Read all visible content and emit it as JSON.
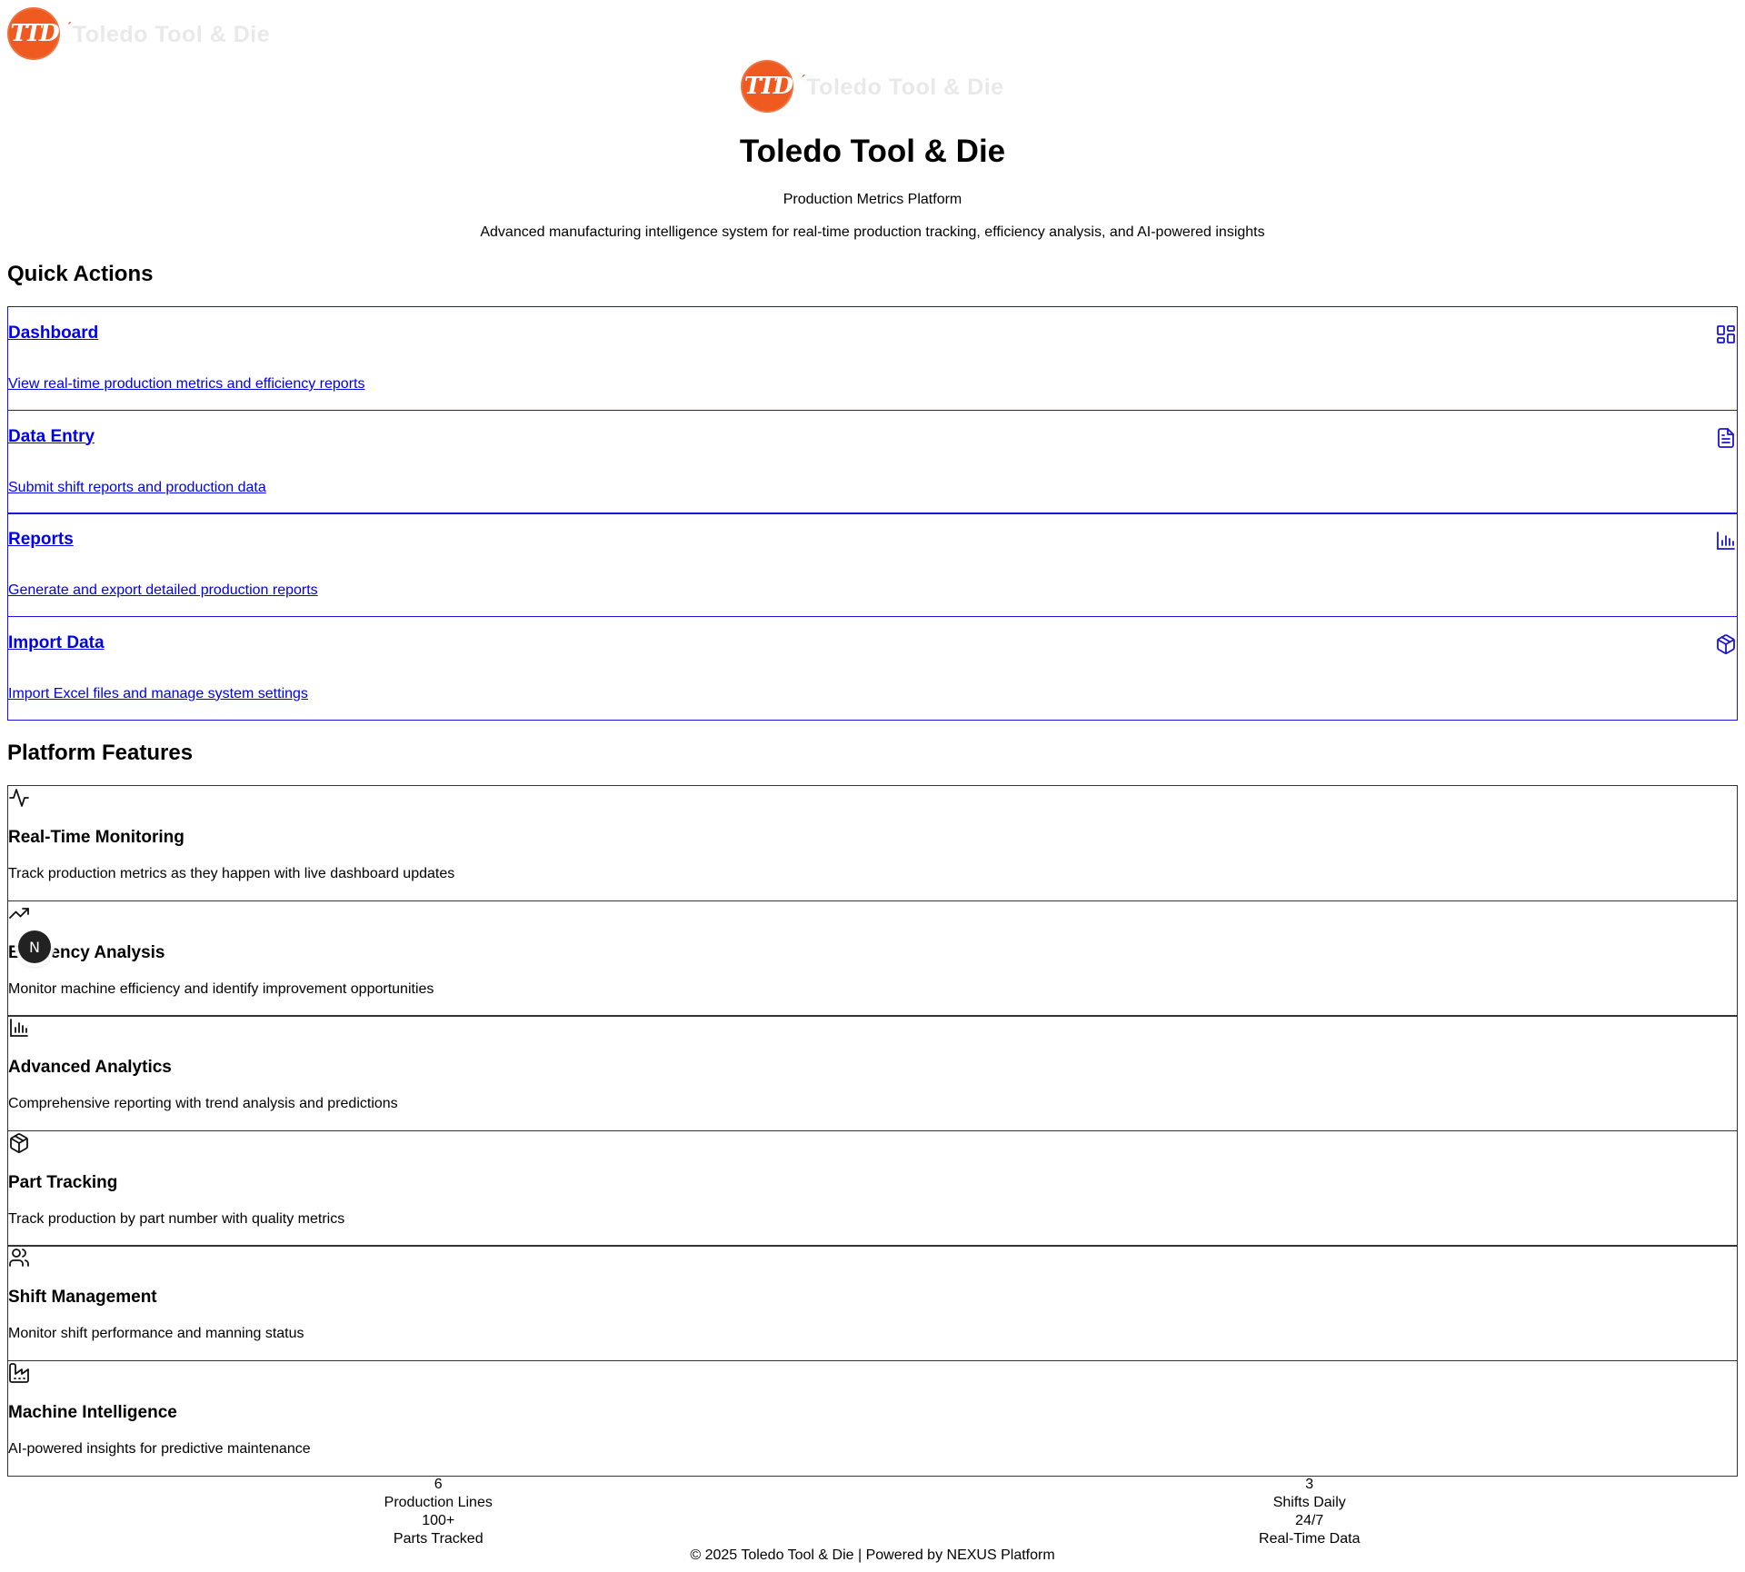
{
  "brand": {
    "logo_initials": "TTD",
    "logo_wordmark": "Toledo Tool & Die",
    "accent_color": "#ee5a1f"
  },
  "hero": {
    "title": "Toledo Tool & Die",
    "subtitle": "Production Metrics Platform",
    "description": "Advanced manufacturing intelligence system for real-time production tracking, efficiency analysis, and AI-powered insights"
  },
  "quick_actions": {
    "heading": "Quick Actions",
    "items": [
      {
        "title": "Dashboard",
        "description": "View real-time production metrics and efficiency reports",
        "icon": "dashboard-grid-icon"
      },
      {
        "title": "Data Entry",
        "description": "Submit shift reports and production data",
        "icon": "document-icon"
      },
      {
        "title": "Reports",
        "description": "Generate and export detailed production reports",
        "icon": "bar-chart-icon"
      },
      {
        "title": "Import Data",
        "description": "Import Excel files and manage system settings",
        "icon": "package-icon"
      }
    ]
  },
  "features": {
    "heading": "Platform Features",
    "items": [
      {
        "title": "Real-Time Monitoring",
        "description": "Track production metrics as they happen with live dashboard updates",
        "icon": "activity-icon"
      },
      {
        "title": "Efficiency Analysis",
        "description": "Monitor machine efficiency and identify improvement opportunities",
        "icon": "trending-up-icon"
      },
      {
        "title": "Advanced Analytics",
        "description": "Comprehensive reporting with trend analysis and predictions",
        "icon": "bar-chart-icon"
      },
      {
        "title": "Part Tracking",
        "description": "Track production by part number with quality metrics",
        "icon": "package-icon"
      },
      {
        "title": "Shift Management",
        "description": "Monitor shift performance and manning status",
        "icon": "users-icon"
      },
      {
        "title": "Machine Intelligence",
        "description": "AI-powered insights for predictive maintenance",
        "icon": "factory-icon"
      }
    ]
  },
  "stats": [
    {
      "value": "6",
      "label": "Production Lines",
      "value2": "100+",
      "label2": "Parts Tracked"
    },
    {
      "value": "3",
      "label": "Shifts Daily",
      "value2": "24/7",
      "label2": "Real-Time Data"
    }
  ],
  "footer": {
    "text": "© 2025 Toledo Tool & Die | Powered by NEXUS Platform"
  },
  "dev_badge": {
    "letter": "N"
  }
}
